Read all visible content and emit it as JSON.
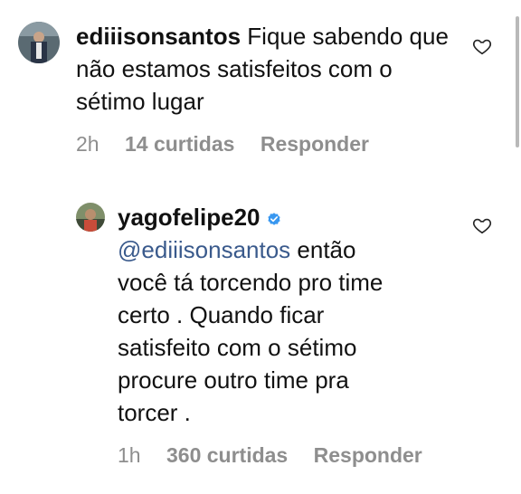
{
  "comments": [
    {
      "username": "ediiisonsantos",
      "text": "Fique sabendo que não estamos satisfeitos com o sétimo lugar",
      "time": "2h",
      "likes": "14 curtidas",
      "reply": "Responder",
      "verified": false,
      "avatar_icon": "avatar-photo"
    },
    {
      "username": "yagofelipe20",
      "mention": "@ediiisonsantos",
      "text_lines": [
        "então",
        "você tá torcendo pro time",
        "certo . Quando ficar",
        "satisfeito com o sétimo",
        "procure outro time pra",
        "torcer ."
      ],
      "time": "1h",
      "likes": "360 curtidas",
      "reply": "Responder",
      "verified": true,
      "avatar_icon": "avatar-photo"
    }
  ],
  "colors": {
    "text": "#111111",
    "meta": "#8e8e8e",
    "mention": "#3a5a8c",
    "verified": "#3897f0"
  }
}
